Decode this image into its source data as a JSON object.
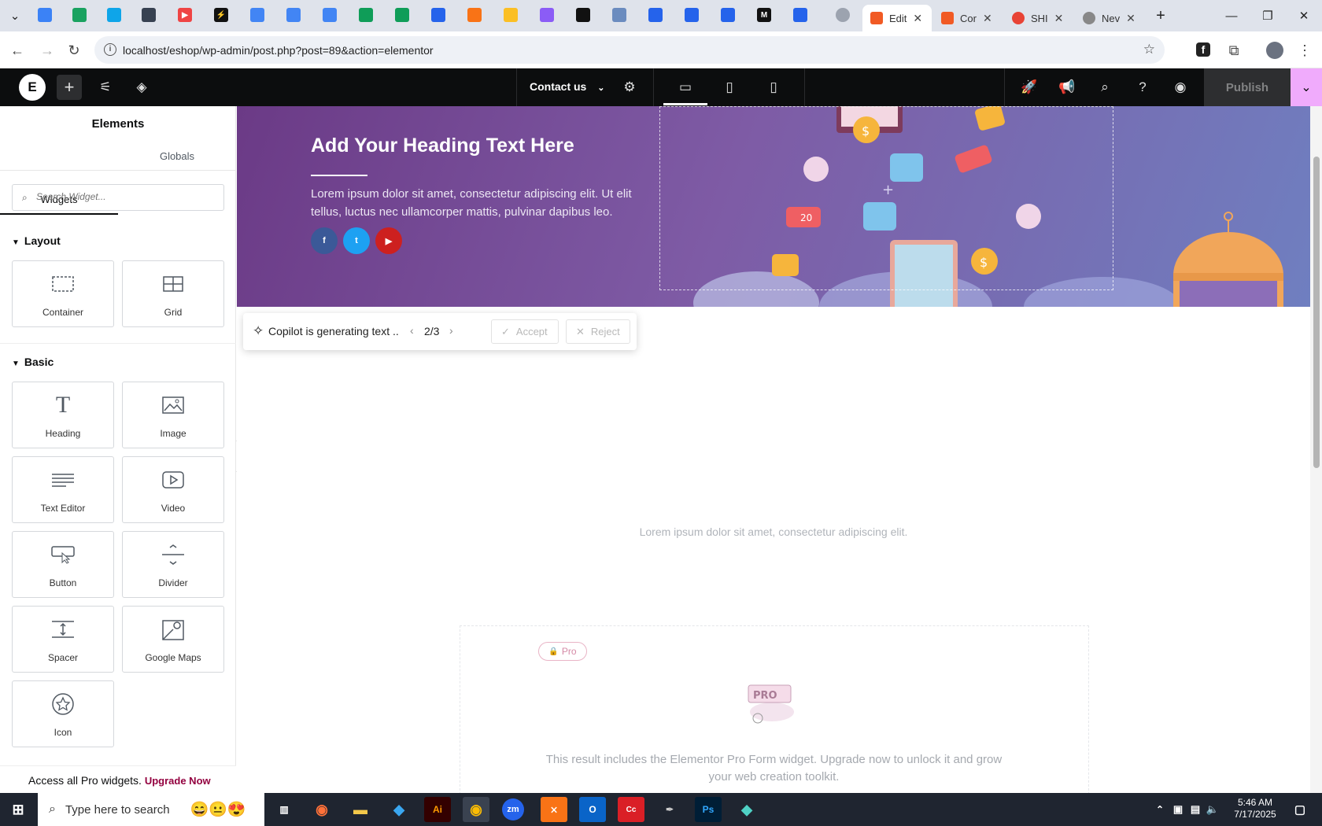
{
  "browser": {
    "tabs": [
      {
        "label": "Edit",
        "active": true,
        "color": "#f15a24"
      },
      {
        "label": "Cor",
        "active": false,
        "color": "#f15a24"
      },
      {
        "label": "SHI",
        "active": false,
        "color": "#e84335"
      },
      {
        "label": "Nev",
        "active": false,
        "color": "#888888"
      }
    ],
    "url": "localhost/eshop/wp-admin/post.php?post=89&action=elementor"
  },
  "editor": {
    "page_name": "Contact us",
    "publish_label": "Publish",
    "brand_color": "#f0abfc"
  },
  "panel": {
    "title": "Elements",
    "tabs": [
      "Widgets",
      "Globals"
    ],
    "search_placeholder": "Search Widget...",
    "layout_title": "Layout",
    "basic_title": "Basic",
    "layout_widgets": [
      {
        "label": "Container",
        "icon": "container-icon"
      },
      {
        "label": "Grid",
        "icon": "grid-icon"
      }
    ],
    "basic_widgets": [
      {
        "label": "Heading",
        "icon": "heading-icon"
      },
      {
        "label": "Image",
        "icon": "image-icon"
      },
      {
        "label": "Text Editor",
        "icon": "text-editor-icon"
      },
      {
        "label": "Video",
        "icon": "video-icon"
      },
      {
        "label": "Button",
        "icon": "button-icon"
      },
      {
        "label": "Divider",
        "icon": "divider-icon"
      },
      {
        "label": "Spacer",
        "icon": "spacer-icon"
      },
      {
        "label": "Google Maps",
        "icon": "google-maps-icon"
      },
      {
        "label": "Icon",
        "icon": "star-icon"
      }
    ],
    "footer_text": "Access all Pro widgets.",
    "footer_link": "Upgrade Now"
  },
  "canvas": {
    "hero_title": "Add Your Heading Text Here",
    "hero_text": "Lorem ipsum dolor sit amet, consectetur adipiscing elit. Ut elit tellus, luctus nec ullamcorper mattis, pulvinar dapibus leo.",
    "copilot": {
      "message": "Copilot is generating text ..",
      "pager": "2/3",
      "accept": "Accept",
      "reject": "Reject"
    },
    "lorem2": "Lorem ipsum dolor sit amet, consectetur adipiscing elit.",
    "pro_badge": "Pro",
    "pro_text": "This result includes the Elementor Pro Form widget. Upgrade now to unlock it and grow your web creation toolkit."
  },
  "taskbar": {
    "search_placeholder": "Type here to search",
    "time": "5:46 AM",
    "date": "7/17/2025"
  }
}
